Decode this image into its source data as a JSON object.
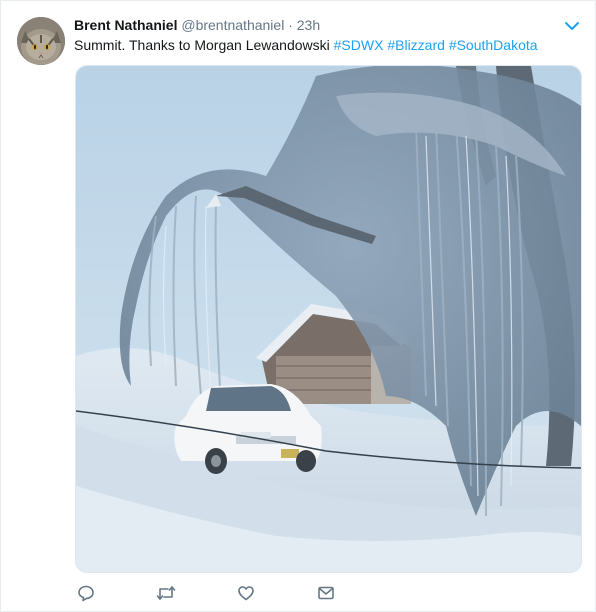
{
  "tweet": {
    "author_name": "Brent Nathaniel",
    "handle": "@brentnathaniel",
    "separator": "·",
    "time": "23h",
    "text_plain": "Summit.  Thanks to Morgan Lewandowski",
    "hashtags": [
      "#SDWX",
      "#Blizzard",
      "#SouthDakota"
    ]
  },
  "icons": {
    "caret": "chevron-down-icon",
    "reply": "reply-icon",
    "retweet": "retweet-icon",
    "like": "heart-icon",
    "dm": "envelope-icon"
  },
  "colors": {
    "link": "#1da1f2",
    "secondary_text": "#657786",
    "primary_text": "#14171a",
    "caret": "#1da1f2"
  }
}
